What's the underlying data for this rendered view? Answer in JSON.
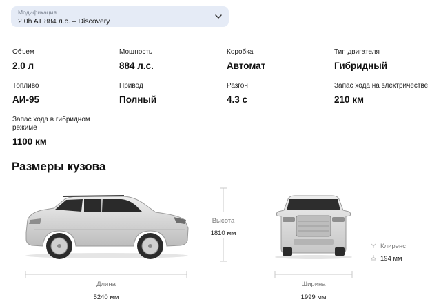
{
  "modification": {
    "label": "Модификация",
    "value": "2.0h AT 884 л.с. – Discovery",
    "icon": "chevron-down-icon"
  },
  "specs": [
    {
      "label": "Объем",
      "value": "2.0 л"
    },
    {
      "label": "Мощность",
      "value": "884 л.с."
    },
    {
      "label": "Коробка",
      "value": "Автомат"
    },
    {
      "label": "Тип двигателя",
      "value": "Гибридный"
    },
    {
      "label": "Топливо",
      "value": "АИ-95"
    },
    {
      "label": "Привод",
      "value": "Полный"
    },
    {
      "label": "Разгон",
      "value": "4.3 с"
    },
    {
      "label": "Запас хода на электричестве",
      "value": "210 км"
    },
    {
      "label": "Запас хода в гибридном режиме",
      "value": "1100 км"
    }
  ],
  "dimensions": {
    "title": "Размеры кузова",
    "height": {
      "label": "Высота",
      "value": "1810 мм"
    },
    "length": {
      "label": "Длина",
      "value": "5240 мм"
    },
    "width": {
      "label": "Ширина",
      "value": "1999 мм"
    },
    "clearance": {
      "label": "Клиренс",
      "value": "194 мм"
    }
  },
  "colors": {
    "select_bg": "#e5ebf6",
    "car_body": "#d8d8d8",
    "dim_line": "#c8c8c8"
  }
}
